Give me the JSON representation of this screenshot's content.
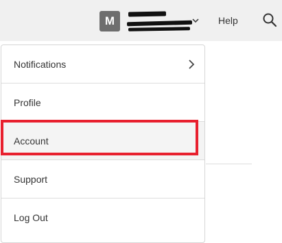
{
  "header": {
    "avatar_initial": "M",
    "help_label": "Help",
    "icons": [
      "chevron-down-icon",
      "search-icon"
    ]
  },
  "menu": {
    "items": [
      {
        "label": "Notifications",
        "has_submenu": true
      },
      {
        "label": "Profile"
      },
      {
        "label": "Account",
        "highlighted": true
      },
      {
        "label": "Support"
      },
      {
        "label": "Log Out"
      }
    ]
  },
  "colors": {
    "topbar_bg": "#f0f0f0",
    "avatar_bg": "#6e6e6e",
    "highlight_border": "#e8202e",
    "text": "#333333"
  }
}
